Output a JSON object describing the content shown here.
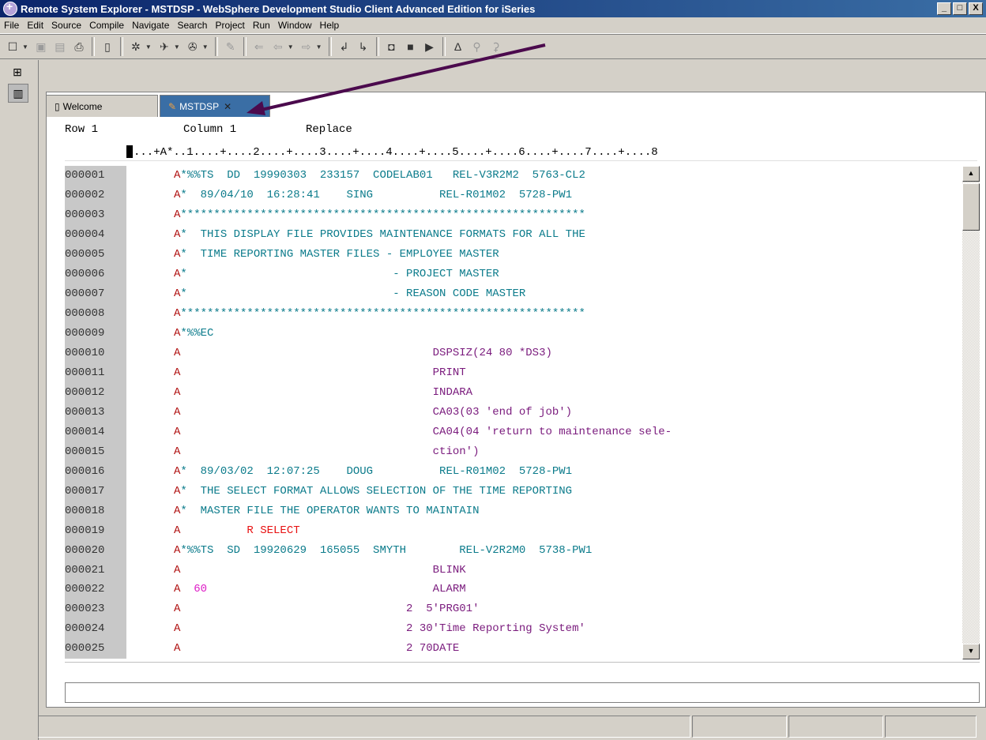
{
  "window": {
    "title": "Remote System Explorer - MSTDSP - WebSphere Development Studio Client Advanced Edition for iSeries",
    "controls": [
      "_",
      "□",
      "X"
    ]
  },
  "menu": [
    "File",
    "Edit",
    "Source",
    "Compile",
    "Navigate",
    "Search",
    "Project",
    "Run",
    "Window",
    "Help"
  ],
  "tabs": [
    {
      "label": "Welcome",
      "icon": "page-icon",
      "active": false
    },
    {
      "label": "MSTDSP",
      "icon": "pencil-icon",
      "active": true
    }
  ],
  "editor_status": {
    "row": "Row 1",
    "column": "Column 1",
    "mode": "Replace"
  },
  "ruler": "...+A*..1....+....2....+....3....+....4....+....5....+....6....+....7....+....8",
  "lines": [
    {
      "num": "000001",
      "segments": [
        {
          "t": "A*%%TS  DD  19990303  233157  CODELAB01   REL-V3R2M2  5763-CL2",
          "c": "teal",
          "a": true
        }
      ]
    },
    {
      "num": "000002",
      "segments": [
        {
          "t": "A*  89/04/10  16:28:41    SING          REL-R01M02  5728-PW1",
          "c": "teal",
          "a": true
        }
      ]
    },
    {
      "num": "000003",
      "segments": [
        {
          "t": "A*************************************************************",
          "c": "teal",
          "a": true
        }
      ]
    },
    {
      "num": "000004",
      "segments": [
        {
          "t": "A*  THIS DISPLAY FILE PROVIDES MAINTENANCE FORMATS FOR ALL THE",
          "c": "teal",
          "a": true
        }
      ]
    },
    {
      "num": "000005",
      "segments": [
        {
          "t": "A*  TIME REPORTING MASTER FILES - EMPLOYEE MASTER",
          "c": "teal",
          "a": true
        }
      ]
    },
    {
      "num": "000006",
      "segments": [
        {
          "t": "A*                               - PROJECT MASTER",
          "c": "teal",
          "a": true
        }
      ]
    },
    {
      "num": "000007",
      "segments": [
        {
          "t": "A*                               - REASON CODE MASTER",
          "c": "teal",
          "a": true
        }
      ]
    },
    {
      "num": "000008",
      "segments": [
        {
          "t": "A*************************************************************",
          "c": "teal",
          "a": true
        }
      ]
    },
    {
      "num": "000009",
      "segments": [
        {
          "t": "A*%%EC",
          "c": "teal",
          "a": true
        }
      ]
    },
    {
      "num": "000010",
      "segments": [
        {
          "t": "A",
          "c": "red"
        },
        {
          "t": "                                      DSPSIZ(24 80 *DS3)",
          "c": "purple"
        }
      ]
    },
    {
      "num": "000011",
      "segments": [
        {
          "t": "A",
          "c": "red"
        },
        {
          "t": "                                      PRINT",
          "c": "purple"
        }
      ]
    },
    {
      "num": "000012",
      "segments": [
        {
          "t": "A",
          "c": "red"
        },
        {
          "t": "                                      INDARA",
          "c": "purple"
        }
      ]
    },
    {
      "num": "000013",
      "segments": [
        {
          "t": "A",
          "c": "red"
        },
        {
          "t": "                                      CA03(03 'end of job')",
          "c": "purple"
        }
      ]
    },
    {
      "num": "000014",
      "segments": [
        {
          "t": "A",
          "c": "red"
        },
        {
          "t": "                                      CA04(04 'return to maintenance sele-",
          "c": "purple"
        }
      ]
    },
    {
      "num": "000015",
      "segments": [
        {
          "t": "A",
          "c": "red"
        },
        {
          "t": "                                      ction')",
          "c": "purple"
        }
      ]
    },
    {
      "num": "000016",
      "segments": [
        {
          "t": "A*  89/03/02  12:07:25    DOUG          REL-R01M02  5728-PW1",
          "c": "teal",
          "a": true
        }
      ]
    },
    {
      "num": "000017",
      "segments": [
        {
          "t": "A*  THE SELECT FORMAT ALLOWS SELECTION OF THE TIME REPORTING",
          "c": "teal",
          "a": true
        }
      ]
    },
    {
      "num": "000018",
      "segments": [
        {
          "t": "A*  MASTER FILE THE OPERATOR WANTS TO MAINTAIN",
          "c": "teal",
          "a": true
        }
      ]
    },
    {
      "num": "000019",
      "segments": [
        {
          "t": "A",
          "c": "red"
        },
        {
          "t": "          R SELECT",
          "c": "brightred"
        }
      ]
    },
    {
      "num": "000020",
      "segments": [
        {
          "t": "A*%%TS  SD  19920629  165055  SMYTH        REL-V2R2M0  5738-PW1",
          "c": "teal",
          "a": true
        }
      ]
    },
    {
      "num": "000021",
      "segments": [
        {
          "t": "A",
          "c": "red"
        },
        {
          "t": "                                      BLINK",
          "c": "purple"
        }
      ]
    },
    {
      "num": "000022",
      "segments": [
        {
          "t": "A",
          "c": "red"
        },
        {
          "t": "  60",
          "c": "mag"
        },
        {
          "t": "                                  ALARM",
          "c": "purple"
        }
      ]
    },
    {
      "num": "000023",
      "segments": [
        {
          "t": "A",
          "c": "red"
        },
        {
          "t": "                                  2  5'PRG01'",
          "c": "purple"
        }
      ]
    },
    {
      "num": "000024",
      "segments": [
        {
          "t": "A",
          "c": "red"
        },
        {
          "t": "                                  2 30'Time Reporting System'",
          "c": "purple"
        }
      ]
    },
    {
      "num": "000025",
      "segments": [
        {
          "t": "A",
          "c": "red"
        },
        {
          "t": "                                  2 70DATE",
          "c": "purple"
        }
      ]
    }
  ],
  "colors": {
    "title_gradient_start": "#0a246a",
    "title_gradient_end": "#3a6ea5",
    "active_tab": "#3a6ea5",
    "line_number_bg": "#c8c8c8",
    "annotation_arrow": "#4b0a4d"
  }
}
